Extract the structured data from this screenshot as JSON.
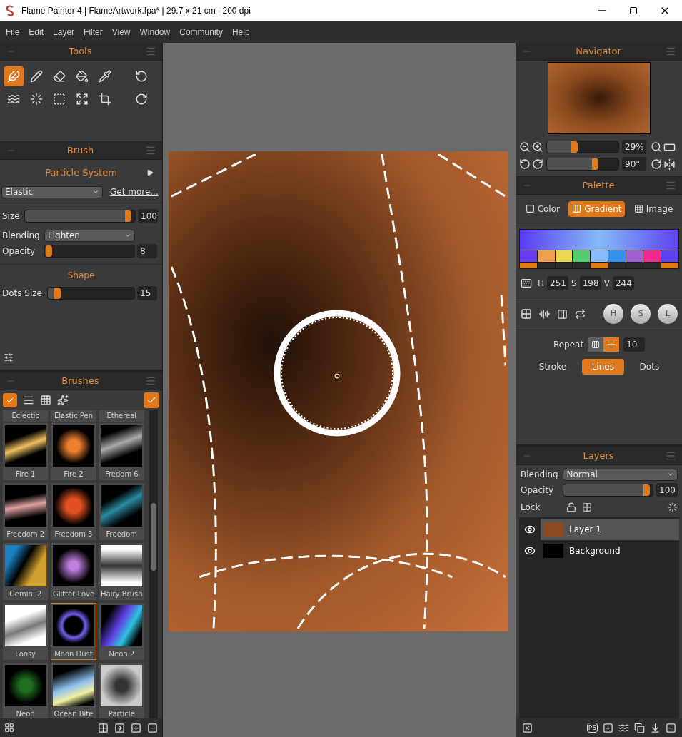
{
  "window": {
    "title": "Flame Painter 4 | FlameArtwork.fpa* | 29.7 x 21 cm | 200 dpi"
  },
  "menu": [
    "File",
    "Edit",
    "Layer",
    "Filter",
    "View",
    "Window",
    "Community",
    "Help"
  ],
  "tools": {
    "title": "Tools",
    "items": [
      {
        "selected": true
      },
      {
        "selected": false
      },
      {
        "selected": false
      },
      {
        "selected": false
      },
      {
        "selected": false
      },
      {
        "selected": false
      },
      {
        "selected": false
      },
      {
        "selected": false
      },
      {
        "selected": false
      },
      {
        "selected": false
      }
    ]
  },
  "brush": {
    "title": "Brush",
    "preset": "Particle System",
    "category": "Elastic",
    "link": "Get more...",
    "size": {
      "label": "Size",
      "level": 0.97,
      "reading": "100"
    },
    "blending": {
      "label": "Blending",
      "value": "Lighten"
    },
    "opacity": {
      "label": "Opacity",
      "level": 0.08,
      "reading": "8"
    },
    "shape_title": "Shape",
    "dots_size": {
      "label": "Dots Size",
      "level": 0.15,
      "reading": "15"
    }
  },
  "brushes": {
    "title": "Brushes",
    "cut_off_row": [
      "Eclectic",
      "Elastic Pen",
      "Ethereal"
    ],
    "items": [
      {
        "label": "Fire 1",
        "selected": false
      },
      {
        "label": "Fire 2",
        "selected": false
      },
      {
        "label": "Fredom 6",
        "selected": false
      },
      {
        "label": "Freedom 2",
        "selected": false
      },
      {
        "label": "Freedom 3",
        "selected": false
      },
      {
        "label": "Freedom",
        "selected": false
      },
      {
        "label": "Gemini 2",
        "selected": false
      },
      {
        "label": "Glitter Love",
        "selected": false
      },
      {
        "label": "Hairy Brush",
        "selected": false
      },
      {
        "label": "Loosy",
        "selected": false
      },
      {
        "label": "Moon Dust",
        "selected": true
      },
      {
        "label": "Neon 2",
        "selected": false
      },
      {
        "label": "Neon",
        "selected": false
      },
      {
        "label": "Ocean Bite",
        "selected": false
      },
      {
        "label": "Particle",
        "selected": false
      }
    ]
  },
  "navigator": {
    "title": "Navigator",
    "zoom": {
      "level": 0.43,
      "reading": "29%"
    },
    "rotation": {
      "level": 0.72,
      "reading": "90°"
    }
  },
  "palette": {
    "title": "Palette",
    "tabs": [
      {
        "label": "Color",
        "selected": false
      },
      {
        "label": "Gradient",
        "selected": true
      },
      {
        "label": "Image",
        "selected": false
      }
    ],
    "swatches": [
      {
        "color": "#6a3cf0",
        "marked": true
      },
      {
        "color": "#f0a050",
        "marked": false
      },
      {
        "color": "#ecd84e",
        "marked": false
      },
      {
        "color": "#52cc6e",
        "marked": false
      },
      {
        "color": "#86baf8",
        "marked": true
      },
      {
        "color": "#3290ee",
        "marked": false
      },
      {
        "color": "#a062d2",
        "marked": false
      },
      {
        "color": "#f02a92",
        "marked": false
      },
      {
        "color": "#5e42f0",
        "marked": true
      }
    ],
    "hsv": [
      {
        "label": "H",
        "value": "251"
      },
      {
        "label": "S",
        "value": "198"
      },
      {
        "label": "V",
        "value": "244"
      }
    ],
    "knobs": [
      "H",
      "S",
      "L"
    ],
    "repeat": {
      "label": "Repeat",
      "modes": [
        {
          "selected": false
        },
        {
          "selected": true
        }
      ],
      "value": "10"
    },
    "styles": [
      {
        "label": "Stroke",
        "selected": false
      },
      {
        "label": "Lines",
        "selected": true
      },
      {
        "label": "Dots",
        "selected": false
      }
    ]
  },
  "layers": {
    "title": "Layers",
    "blending": {
      "label": "Blending",
      "value": "Normal"
    },
    "opacity": {
      "label": "Opacity",
      "level": 0.97,
      "reading": "100"
    },
    "lock_label": "Lock",
    "items": [
      {
        "name": "Layer 1",
        "selected": true,
        "visible": true
      },
      {
        "name": "Background",
        "selected": false,
        "visible": true
      }
    ],
    "export_label": "PS"
  }
}
